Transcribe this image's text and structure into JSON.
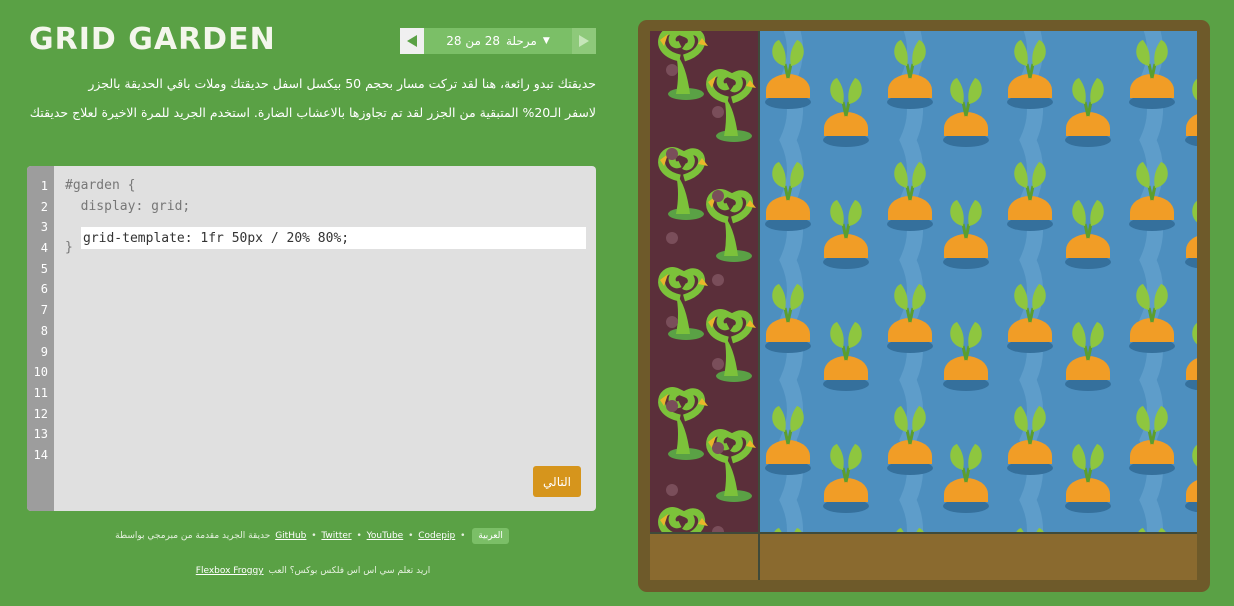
{
  "app": {
    "title": "GRID GARDEN"
  },
  "level_nav": {
    "level_label": "مرحلة",
    "level_progress": "28 من 28",
    "current_level": 28,
    "total_levels": 28
  },
  "instructions": {
    "paragraphs": [
      "حديقتك تبدو رائعة، هنا لقد تركت مسار بحجم 50 بيكسل اسفل حديقتك وملات باقي الحديقة بالجزر",
      "لاسفر الـ20% المتبقية من الجزر لقد تم تجاوزها بالاعشاب الضارة. استخدم الجريد للمرة الاخيرة لعلاج حديقتك"
    ]
  },
  "editor": {
    "line_numbers": [
      "1",
      "2",
      "3",
      "4",
      "5",
      "6",
      "7",
      "8",
      "9",
      "10",
      "11",
      "12",
      "13",
      "14"
    ],
    "code_lines": [
      "#garden {",
      "  display: grid;",
      "",
      "}"
    ],
    "input_value": "grid-template: 1fr 50px / 20% 80%;",
    "next_label": "التالي"
  },
  "footer": {
    "language_label": "العربية",
    "links": [
      "GitHub",
      "Twitter",
      "YouTube",
      "Codepip"
    ],
    "credit_text": "حديقة الجريد مقدمة من مبرمجي بواسطة",
    "froggy_prefix": "اللعب؟ اس اس فلكس بوكس؟",
    "froggy_text": "اريد تعلم سي اس اس فلكس بوكس؟ العب",
    "froggy_link": "Flexbox Froggy"
  },
  "colors": {
    "background": "#5aa145",
    "garden_frame": "#6e5a2a",
    "water": "#4d8fbf",
    "weed_soil": "#5b2f3a",
    "path_soil": "#8a6a2f",
    "carrot": "#f19d26",
    "leaf": "#8ec63f",
    "next_button": "#d6951c"
  }
}
